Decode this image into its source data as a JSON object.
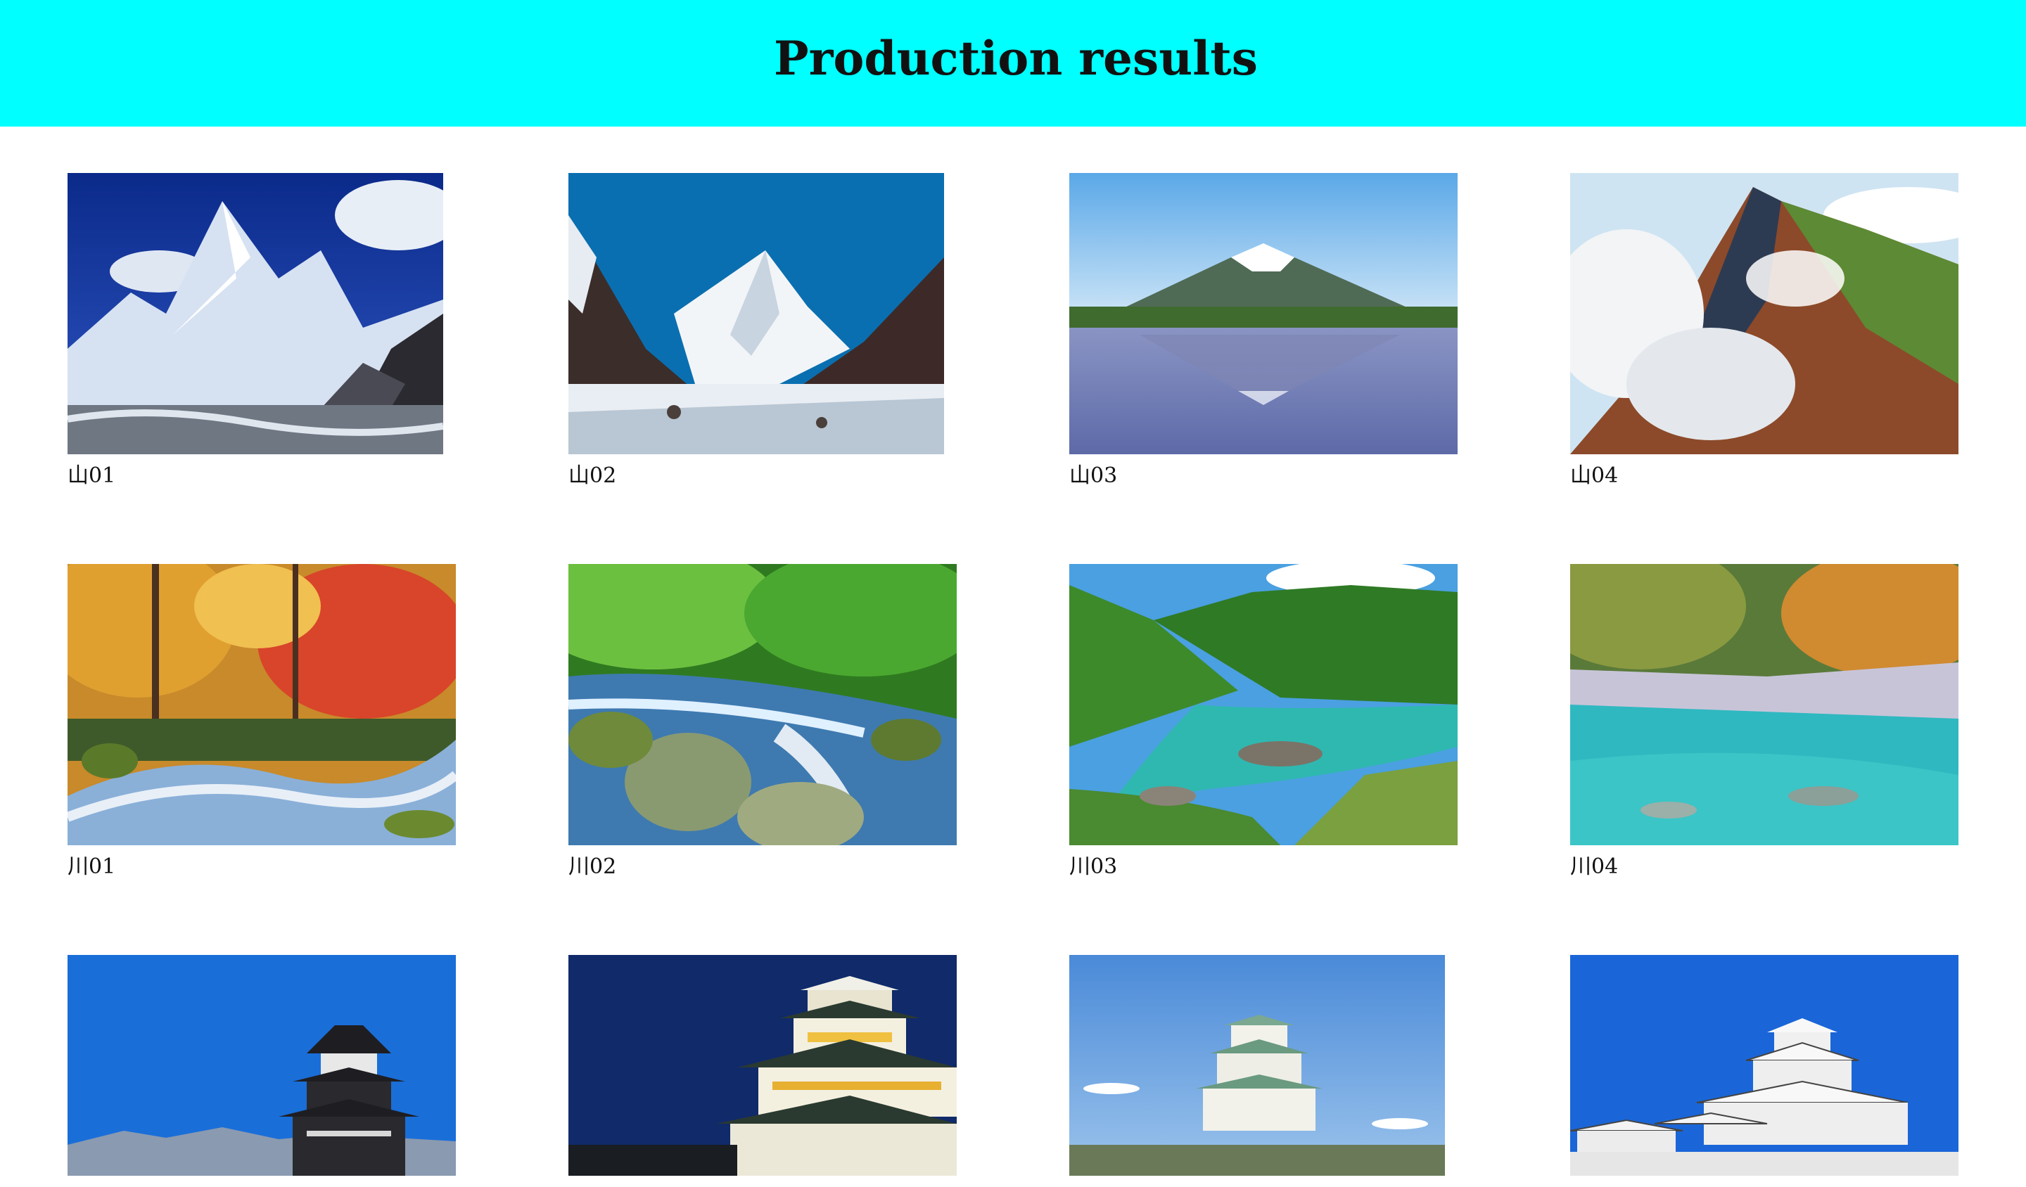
{
  "header": {
    "title": "Production results"
  },
  "colors": {
    "header_bg": "#00ffff",
    "page_bg": "#ffffff"
  },
  "gallery": {
    "items": [
      {
        "caption": "山01",
        "scene": "mountain-k2-snow"
      },
      {
        "caption": "山02",
        "scene": "mountain-k2-glacier"
      },
      {
        "caption": "山03",
        "scene": "mountain-fuji-reflection"
      },
      {
        "caption": "山04",
        "scene": "mountain-ridge-clouds"
      },
      {
        "caption": "川01",
        "scene": "river-autumn-forest"
      },
      {
        "caption": "川02",
        "scene": "river-mossy-stream"
      },
      {
        "caption": "川03",
        "scene": "river-valley-turquoise"
      },
      {
        "caption": "川04",
        "scene": "river-gorge-clear"
      },
      {
        "caption": "",
        "scene": "castle-matsumoto"
      },
      {
        "caption": "",
        "scene": "castle-osaka-night"
      },
      {
        "caption": "",
        "scene": "castle-osaka-day"
      },
      {
        "caption": "",
        "scene": "castle-himeji"
      }
    ]
  }
}
